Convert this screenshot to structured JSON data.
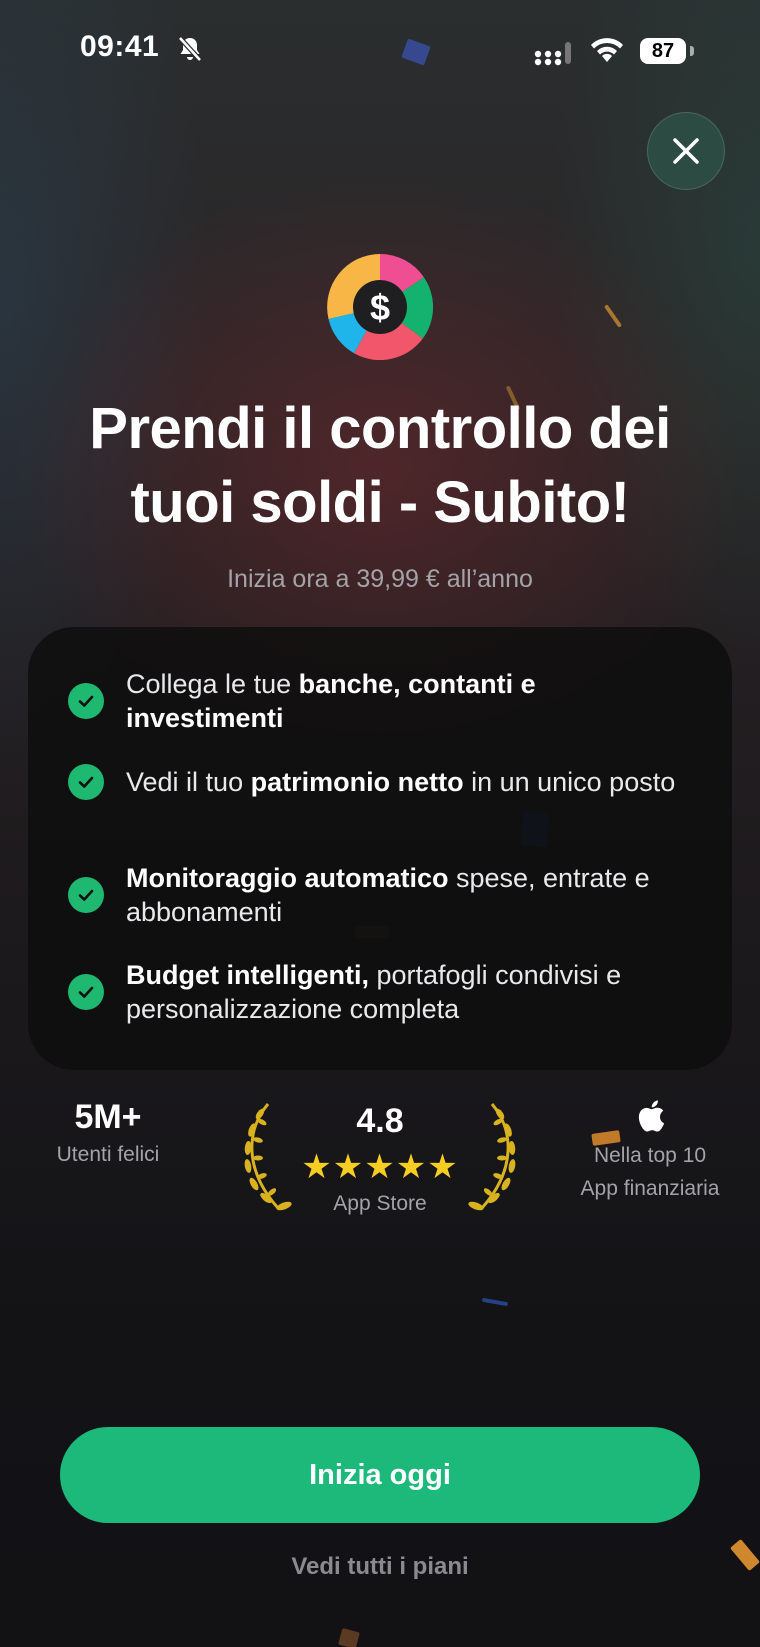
{
  "status_bar": {
    "time": "09:41",
    "battery": "87",
    "icons": [
      "bell-off-icon",
      "cellular-signal-icon",
      "wifi-icon",
      "battery-icon"
    ]
  },
  "close_icon": "close-icon",
  "logo_icon": "dollar-pie-logo-icon",
  "headline": {
    "line1": "Prendi il controllo dei",
    "line2": "tuoi soldi - Subito!"
  },
  "price_line": "Inizia ora a 39,99 € all’anno",
  "features": [
    {
      "bold_lead": "",
      "text": "Collega le tue ",
      "bold": "banche, contanti e investimenti",
      "tail": ""
    },
    {
      "bold_lead": "",
      "text": "Vedi il tuo ",
      "bold": "patrimonio netto",
      "tail": " in un unico posto"
    },
    {
      "bold_lead": "Monitoraggio automatico",
      "text": " spese, entrate e abbonamenti",
      "bold": "",
      "tail": ""
    },
    {
      "bold_lead": "Budget intelligenti,",
      "text": " portafogli condivisi e personalizzazione completa",
      "bold": "",
      "tail": ""
    }
  ],
  "stats": {
    "users_value": "5M+",
    "users_label": "Utenti felici",
    "rating_value": "4.8",
    "rating_stars": 5,
    "stars_text": "★★★★★",
    "rating_store": "App Store",
    "apple_line1": "Nella top 10",
    "apple_line2": "App finanziaria"
  },
  "cta_label": "Inizia oggi",
  "plans_link": "Vedi tutti i piani",
  "colors": {
    "accent_green": "#1db97a",
    "check_green": "#1fb870",
    "star_gold": "#f7cd22"
  }
}
